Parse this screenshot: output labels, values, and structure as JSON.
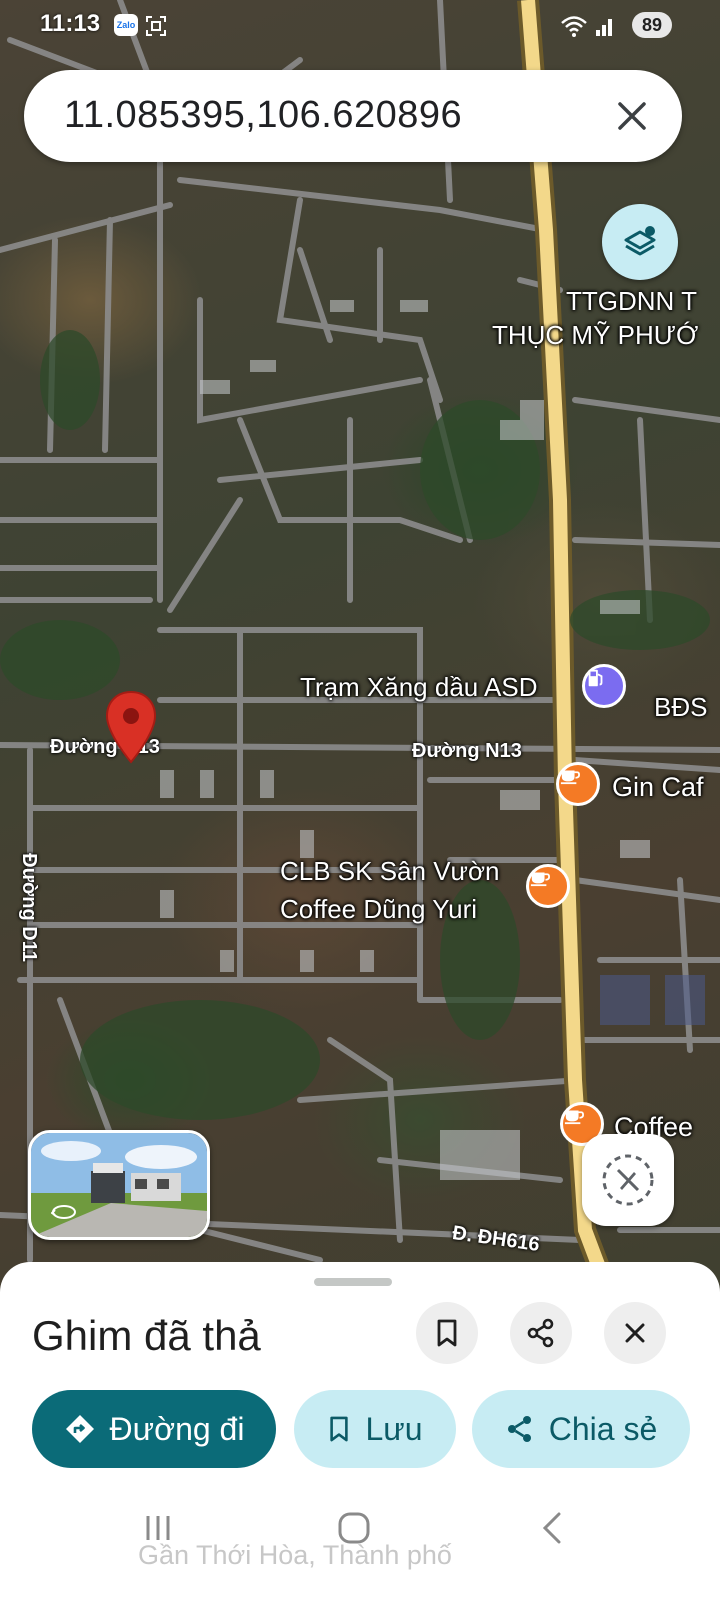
{
  "status_bar": {
    "time": "11:13",
    "app_icon": "Zalo",
    "battery": "89"
  },
  "search": {
    "query": "11.085395,106.620896"
  },
  "map": {
    "labels": {
      "school_line1": "TTGDNN T",
      "school_line2": "THỤC MỸ PHƯỚ",
      "gas_station": "Trạm Xăng dầu ASD",
      "bds": "BĐS",
      "road_n13_left": "Đường N13",
      "road_n13_right": "Đường N13",
      "gin_cafe": "Gin Caf",
      "clb_line1": "CLB SK Sân Vườn",
      "clb_line2": "Coffee Dũng Yuri",
      "road_d11": "Đường D11",
      "coffee_bottom": "Coffee",
      "road_dh616": "Đ. ĐH616"
    },
    "colors": {
      "highway": "#f3d88a",
      "road": "#8c8c8c",
      "pin": "#d93025",
      "cafe": "#f47a25"
    }
  },
  "sheet": {
    "title": "Ghim đã thả",
    "directions_label": "Đường đi",
    "save_label": "Lưu",
    "share_label": "Chia sẻ",
    "subtext": "Gần Thới Hòa, Thành phố"
  }
}
